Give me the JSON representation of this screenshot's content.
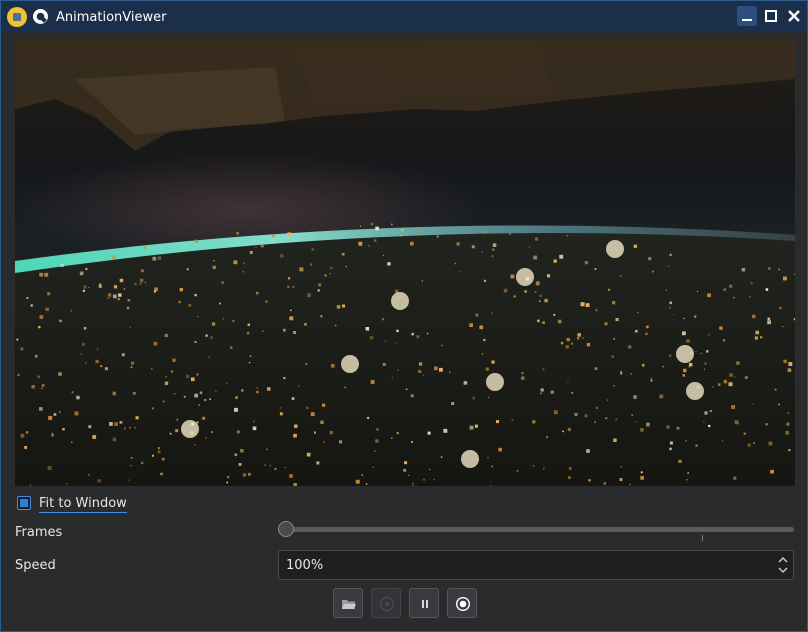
{
  "window": {
    "title": "AnimationViewer",
    "icons": [
      "app-icon",
      "pin-icon"
    ],
    "controls": [
      "minimize-icon",
      "maximize-icon",
      "close-icon"
    ]
  },
  "viewer": {
    "content": "animated-image",
    "fit_to_window": {
      "label": "Fit to Window",
      "checked": true
    }
  },
  "frames": {
    "label": "Frames",
    "position": 0
  },
  "speed": {
    "label": "Speed",
    "value": "100%"
  },
  "toolbar": {
    "buttons": [
      {
        "icon": "folder-open-icon",
        "enabled": true
      },
      {
        "icon": "play-icon",
        "enabled": false
      },
      {
        "icon": "pause-icon",
        "enabled": true
      },
      {
        "icon": "record-icon",
        "enabled": true
      }
    ]
  },
  "colors": {
    "titlebar": "#1b2e4a",
    "window_bg": "#2a2b2d",
    "accent": "#3d8ee6"
  }
}
